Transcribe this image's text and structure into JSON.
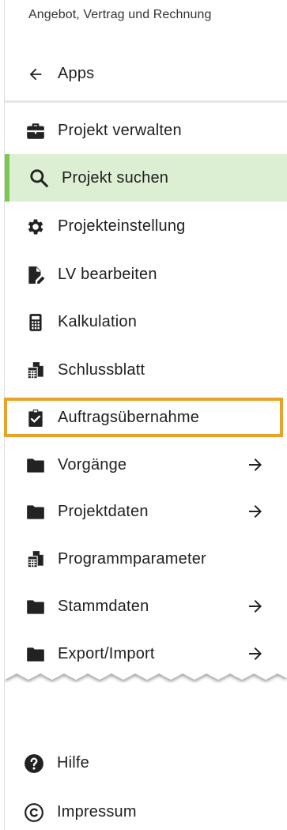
{
  "header": {
    "subtitle": "Angebot, Vertrag und Rechnung"
  },
  "apps": {
    "icon": "arrow-left-icon",
    "label": "Apps"
  },
  "menu": [
    {
      "icon": "briefcase-icon",
      "label": "Projekt verwalten",
      "has_arrow": false
    },
    {
      "icon": "search-icon",
      "label": "Projekt suchen",
      "selected": true,
      "has_arrow": false
    },
    {
      "icon": "gear-icon",
      "label": "Projekteinstellung",
      "has_arrow": false
    },
    {
      "icon": "file-edit-icon",
      "label": "LV bearbeiten",
      "has_arrow": false
    },
    {
      "icon": "calculator-icon",
      "label": "Kalkulation",
      "has_arrow": false
    },
    {
      "icon": "spreadsheet-icon",
      "label": "Schlussblatt",
      "has_arrow": false
    },
    {
      "icon": "clipboard-check-icon",
      "label": "Auftragsübernahme",
      "highlighted": true,
      "has_arrow": false
    },
    {
      "icon": "folder-icon",
      "label": "Vorgänge",
      "has_arrow": true,
      "arrow_icon": "arrow-right-icon"
    },
    {
      "icon": "folder-icon",
      "label": "Projektdaten",
      "has_arrow": true,
      "arrow_icon": "arrow-right-icon"
    },
    {
      "icon": "spreadsheet-icon",
      "label": "Programmparameter",
      "has_arrow": false
    },
    {
      "icon": "folder-icon",
      "label": "Stammdaten",
      "has_arrow": true,
      "arrow_icon": "arrow-right-icon"
    },
    {
      "icon": "folder-icon",
      "label": "Export/Import",
      "has_arrow": true,
      "arrow_icon": "arrow-right-icon"
    }
  ],
  "footer": [
    {
      "icon": "help-circle-icon",
      "label": "Hilfe"
    },
    {
      "icon": "copyright-icon",
      "label": "Impressum"
    }
  ],
  "colors": {
    "selected_bg": "#dcefd3",
    "selected_bar": "#7bc74f",
    "highlight_frame": "#e8a227",
    "icon": "#222222"
  }
}
